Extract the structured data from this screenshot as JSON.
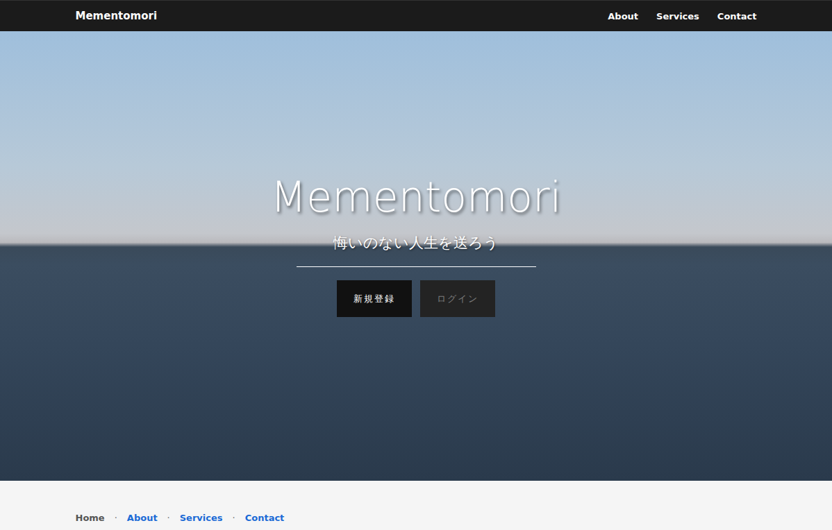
{
  "navbar": {
    "brand": "Mementomori",
    "links": [
      {
        "label": "About"
      },
      {
        "label": "Services"
      },
      {
        "label": "Contact"
      }
    ]
  },
  "hero": {
    "title": "Mementomori",
    "subtitle": "悔いのない人生を送ろう",
    "buttons": [
      {
        "label": "新規登録",
        "kind": "primary"
      },
      {
        "label": "ログイン",
        "kind": "secondary"
      }
    ]
  },
  "footer": {
    "separator": "·",
    "links": [
      {
        "label": "Home",
        "selected": true
      },
      {
        "label": "About",
        "selected": false
      },
      {
        "label": "Services",
        "selected": false
      },
      {
        "label": "Contact",
        "selected": false
      }
    ]
  }
}
